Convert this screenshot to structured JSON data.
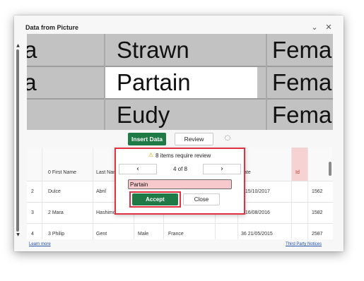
{
  "window": {
    "title": "Data from Picture",
    "controls": {
      "collapse_icon": "chevron-down-icon",
      "close_icon": "close-icon"
    }
  },
  "picture_preview": {
    "rows": [
      {
        "col1": "a",
        "col2": "Strawn",
        "col3": "Fema"
      },
      {
        "col1": "la",
        "col2": "Partain",
        "col3": "Fema"
      },
      {
        "col1": "",
        "col2": "Eudy",
        "col3": "Fema"
      }
    ],
    "highlighted_row": 1
  },
  "toolbar": {
    "insert_label": "Insert Data",
    "review_label": "Review",
    "tip_icon": "lightbulb-icon"
  },
  "grid": {
    "headers": [
      "",
      "0 First Name",
      "Last Nan",
      "",
      "",
      "ate",
      "Id",
      ""
    ],
    "rows": [
      {
        "num": "2",
        "first": "Dulce",
        "last": "Abril",
        "gender": "",
        "country": "",
        "date": "2 15/10/2017",
        "id": "",
        "extra": "1562"
      },
      {
        "num": "3",
        "first": "2 Mara",
        "last": "Hashimo",
        "gender": "",
        "country": "",
        "date": "5 16/08/2016",
        "id": "",
        "extra": "1582"
      },
      {
        "num": "4",
        "first": "3 Philip",
        "last": "Gent",
        "gender": "Male",
        "country": "France",
        "date": "36 21/05/2015",
        "id": "",
        "extra": "2587"
      }
    ]
  },
  "review_popup": {
    "warning_icon": "warning-icon",
    "message": "8 items require review",
    "counter": "4 of 8",
    "prev_icon": "chevron-left-icon",
    "next_icon": "chevron-right-icon",
    "prev_glyph": "‹",
    "next_glyph": "›",
    "current_value": "Partain",
    "accept_label": "Accept",
    "close_label": "Close"
  },
  "footer": {
    "learn_more": "Learn more",
    "notices": "Third Party Notices"
  },
  "colors": {
    "accent_green": "#1f7a45",
    "highlight_red": "#e23140",
    "error_field": "#f8c9cc",
    "id_header": "#f6d2d2"
  }
}
